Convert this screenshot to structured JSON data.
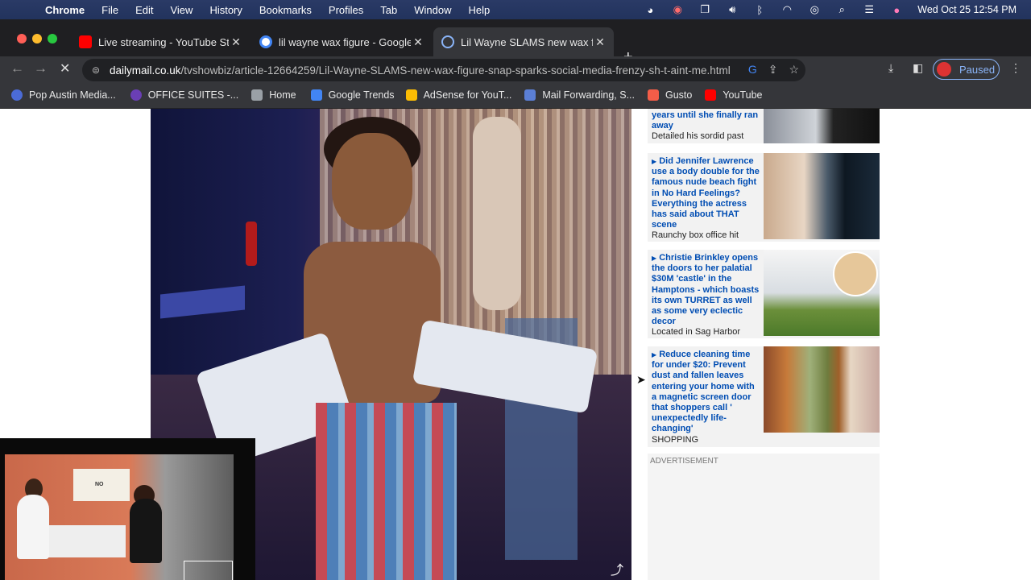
{
  "menubar": {
    "app": "Chrome",
    "items": [
      "File",
      "Edit",
      "View",
      "History",
      "Bookmarks",
      "Profiles",
      "Tab",
      "Window",
      "Help"
    ],
    "clock": "Wed Oct 25  12:54 PM"
  },
  "tabs": [
    {
      "title": "Live streaming - YouTube Stud",
      "favicon_color": "#ff0000"
    },
    {
      "title": "lil wayne wax figure - Google S",
      "favicon_color": "#4285f4"
    },
    {
      "title": "Lil Wayne SLAMS new wax fig",
      "favicon_color": "#5f6368",
      "active": true
    }
  ],
  "toolbar": {
    "url_domain": "dailymail.co.uk",
    "url_path": "/tvshowbiz/article-12664259/Lil-Wayne-SLAMS-new-wax-figure-snap-sparks-social-media-frenzy-sh-t-aint-me.html",
    "profile_label": "Paused"
  },
  "bookmarks": [
    {
      "label": "Pop Austin Media...",
      "color": "#4b6bd6"
    },
    {
      "label": "OFFICE SUITES -...",
      "color": "#6a3fb5"
    },
    {
      "label": "Home",
      "color": "#9aa0a6"
    },
    {
      "label": "Google Trends",
      "color": "#4285f4"
    },
    {
      "label": "AdSense for YouT...",
      "color": "#fbbc04"
    },
    {
      "label": "Mail Forwarding, S...",
      "color": "#5b7fd6"
    },
    {
      "label": "Gusto",
      "color": "#f45d48"
    },
    {
      "label": "YouTube",
      "color": "#ff0000"
    }
  ],
  "stories": [
    {
      "headline": "years until she finally ran away",
      "sub": "Detailed his sordid past"
    },
    {
      "headline": "Did Jennifer Lawrence use a body double for the famous nude beach fight in No Hard Feelings? Everything the actress has said about THAT scene",
      "sub": "Raunchy box office hit"
    },
    {
      "headline": "Christie Brinkley opens the doors to her palatial $30M 'castle' in the Hamptons - which boasts its own TURRET as well as some very eclectic decor",
      "sub": "Located in Sag Harbor"
    },
    {
      "headline": "Reduce cleaning time for under $20: Prevent dust and fallen leaves entering your home with a magnetic screen door that shoppers call ' unexpectedly life-changing'",
      "sub": "SHOPPING"
    }
  ],
  "advert_label": "ADVERTISEMENT",
  "webcam_sign": "NO"
}
